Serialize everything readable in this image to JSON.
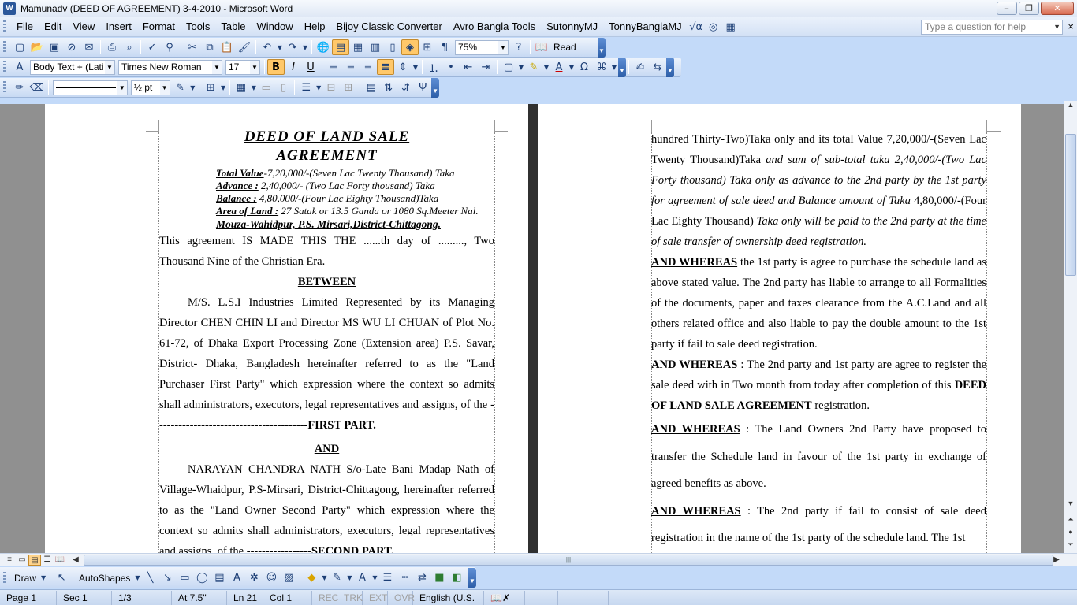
{
  "window": {
    "app_icon": "W",
    "title": "Mamunadv  (DEED OF AGREEMENT) 3-4-2010 - Microsoft Word",
    "buttons": [
      "–",
      "❐",
      "✕"
    ]
  },
  "menu": {
    "items": [
      "File",
      "Edit",
      "View",
      "Insert",
      "Format",
      "Tools",
      "Table",
      "Window",
      "Help",
      "Bijoy Classic Converter",
      "Avro Bangla Tools",
      "SutonnyMJ",
      "TonnyBanglaMJ"
    ],
    "help_placeholder": "Type a question for help",
    "close": "×"
  },
  "standard_toolbar": {
    "zoom": "75%",
    "read_label": "Read",
    "icons": [
      "new-icon",
      "open-icon",
      "save-icon",
      "permission-icon",
      "print-icon",
      "print-preview-icon",
      "spelling-icon",
      "research-icon",
      "cut-icon",
      "copy-icon",
      "paste-icon",
      "format-painter-icon",
      "undo-icon",
      "redo-icon",
      "hyperlink-icon",
      "tables-borders-icon",
      "insert-table-icon",
      "excel-icon",
      "columns-icon",
      "drawing-icon",
      "document-map-icon",
      "show-hide-icon",
      "help-icon"
    ]
  },
  "formatting_toolbar": {
    "style": "Body Text + (Lati",
    "font": "Times New Roman",
    "size": "17",
    "bold": "B",
    "italic": "I",
    "underline": "U",
    "font_color_letter": "A"
  },
  "tables_toolbar": {
    "line_weight": "½ pt"
  },
  "page1": {
    "title_line1": "DEED OF LAND SALE",
    "title_line2": "AGREEMENT",
    "total_value_label": "Total Value",
    "total_value": "-7,20,000/-(Seven Lac Twenty Thousand) Taka",
    "advance_label": "Advance :",
    "advance": " 2,40,000/- (Two Lac Forty thousand) Taka",
    "balance_label": "Balance :",
    "balance": " 4,80,000/-(Four  Lac Eighty Thousand)Taka",
    "area_label": "Area of Land :",
    "area": " 27 Satak or 13.5 Ganda or 1080 Sq.Meeter Nal.",
    "mouza": "Mouza-Wahidpur, P.S. Mirsari,District-Chittagong.",
    "intro": "This agreement IS MADE THIS THE ......th day of ........., Two Thousand Nine of the Christian Era.",
    "between": "BETWEEN",
    "first_party": "M/S. L.S.I Industries Limited Represented by its Managing Director CHEN CHIN LI and Director MS WU LI CHUAN of Plot No. 61-72, of Dhaka Export Processing Zone (Extension area) P.S. Savar, District- Dhaka, Bangladesh hereinafter referred to as the \"Land Purchaser First Party\" which expression where the context so admits shall administrators, executors, legal representatives and assigns, of the ----------------------------------------",
    "first_party_tag": "FIRST PART.",
    "and": "AND",
    "second_party": "NARAYAN CHANDRA NATH S/o-Late Bani Madap Nath of Village-Whaidpur, P.S-Mirsari, District-Chittagong, hereinafter referred to as the \"Land Owner Second Party\" which expression where the context so admits shall administrators, executors, legal representatives and assigns, of the -----------------",
    "second_party_tag": "SECOND PART."
  },
  "page2": {
    "para1_a": "hundred Thirty-Two)Taka only and its total Value 7,20,000/-(Seven Lac Twenty Thousand)Taka ",
    "para1_b": "and sum of sub-total taka 2,40,000/-(Two Lac Forty thousand) Taka only as advance to the 2nd party  by the 1st party for agreement of sale deed and Balance amount of Taka",
    "para1_c": " 4,80,000/-(Four Lac Eighty Thousand) ",
    "para1_d": "Taka only will be paid to the 2nd party at the time of sale transfer of ownership deed registration.",
    "whereas_label": "AND WHEREAS",
    "whereas1": " the 1st party is agree to purchase the schedule land as above stated value. The 2nd party has liable to arrange to all Formalities of the documents, paper and taxes clearance from the A.C.Land and all others related office and also liable to pay the double amount to the 1st party if fail to sale deed registration.",
    "whereas2_a": " : The 2nd party and 1st party are agree to register the sale deed with in Two month from today after completion of this ",
    "whereas2_b": "DEED OF LAND SALE AGREEMENT",
    "whereas2_c": " registration.",
    "whereas3": " : The Land Owners 2nd Party have proposed to transfer the Schedule land in favour of the 1st party in exchange of agreed benefits as above.",
    "whereas4": " : The 2nd party if fail to consist of sale deed registration in the name of the 1st party of the schedule land. The 1st"
  },
  "drawing_toolbar": {
    "draw": "Draw",
    "autoshapes": "AutoShapes"
  },
  "status": {
    "page": "Page 1",
    "sec": "Sec 1",
    "pages": "1/3",
    "at": "At 7.5\"",
    "ln": "Ln 21",
    "col": "Col 1",
    "rec": "REC",
    "trk": "TRK",
    "ext": "EXT",
    "ovr": "OVR",
    "language": "English (U.S."
  }
}
